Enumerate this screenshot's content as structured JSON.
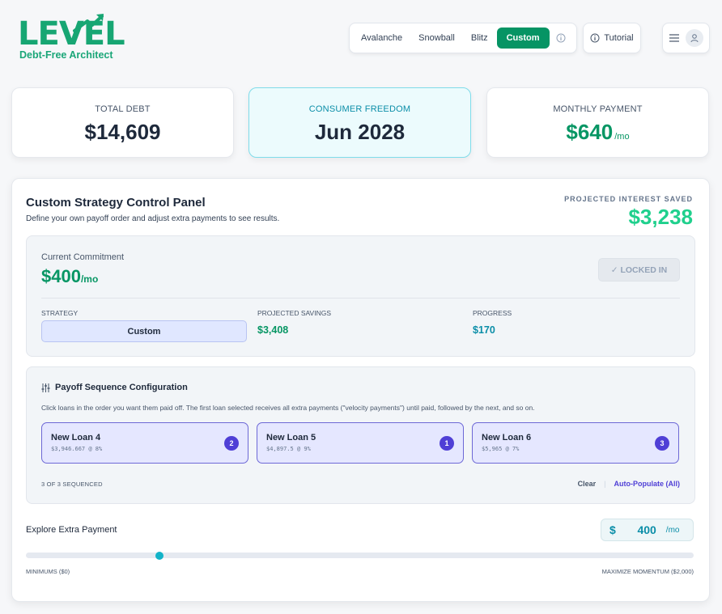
{
  "logo": {
    "word": "LEVEL",
    "tagline": "Debt-Free Architect"
  },
  "header": {
    "tabs": [
      "Avalanche",
      "Snowball",
      "Blitz",
      "Custom"
    ],
    "active_tab": "Custom",
    "tutorial_label": "Tutorial"
  },
  "stats": {
    "total_debt": {
      "label": "TOTAL DEBT",
      "value": "$14,609"
    },
    "consumer_freedom": {
      "label": "CONSUMER FREEDOM",
      "value": "Jun 2028"
    },
    "monthly_payment": {
      "label": "MONTHLY PAYMENT",
      "value": "$640",
      "unit": "/mo"
    }
  },
  "panel": {
    "title": "Custom Strategy Control Panel",
    "subtitle": "Define your own payoff order and adjust extra payments to see results.",
    "interest_saved_label": "PROJECTED INTEREST SAVED",
    "interest_saved_value": "$3,238",
    "commitment": {
      "label": "Current Commitment",
      "value": "$400",
      "unit": "/mo",
      "locked_label": "✓ LOCKED IN",
      "strategy_label": "STRATEGY",
      "strategy_value": "Custom",
      "savings_label": "PROJECTED SAVINGS",
      "savings_value": "$3,408",
      "progress_label": "PROGRESS",
      "progress_value": "$170"
    },
    "sequence": {
      "title": "Payoff Sequence Configuration",
      "description": "Click loans in the order you want them paid off. The first loan selected receives all extra payments (\"velocity payments\") until paid, followed by the next, and so on.",
      "loans": [
        {
          "name": "New Loan 4",
          "meta": "$3,946.667 @ 8%",
          "order": "2"
        },
        {
          "name": "New Loan 5",
          "meta": "$4,897.5 @ 9%",
          "order": "1"
        },
        {
          "name": "New Loan 6",
          "meta": "$5,965 @ 7%",
          "order": "3"
        }
      ],
      "count_label": "3 OF 3 SEQUENCED",
      "clear_label": "Clear",
      "separator": "|",
      "auto_label": "Auto-Populate (All)"
    },
    "extra": {
      "label": "Explore Extra Payment",
      "currency": "$",
      "value": "400",
      "unit": "/mo",
      "min_label": "MINIMUMS ($0)",
      "max_label": "MAXIMIZE MOMENTUM ($2,000)",
      "slider_min": 0,
      "slider_max": 2000,
      "slider_value": 400
    }
  },
  "colors": {
    "brand_green": "#079664",
    "teal": "#0b8ea8",
    "indigo": "#4f3fd6",
    "mint": "#20d08d"
  }
}
